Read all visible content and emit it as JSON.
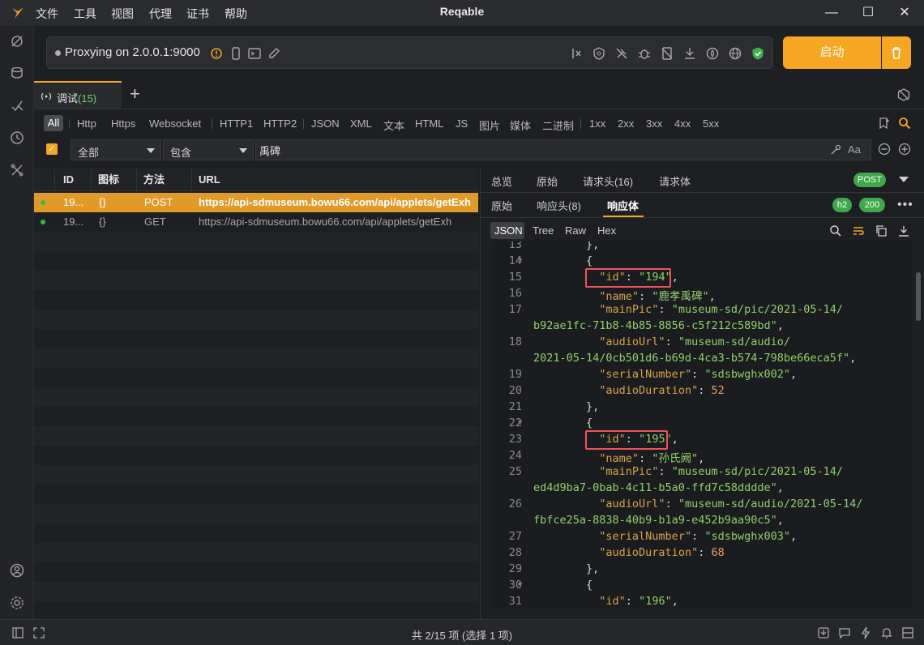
{
  "app": {
    "title": "Reqable",
    "menu": [
      "文件",
      "工具",
      "视图",
      "代理",
      "证书",
      "帮助"
    ]
  },
  "proxy": {
    "status_text": "Proxying on 2.0.0.1:9000",
    "start_label": "启动"
  },
  "tabs": {
    "debug_label": "调试",
    "debug_count": "(15)"
  },
  "filters": [
    "All",
    "Http",
    "Https",
    "Websocket",
    "HTTP1",
    "HTTP2",
    "JSON",
    "XML",
    "文本",
    "HTML",
    "JS",
    "图片",
    "媒体",
    "二进制",
    "1xx",
    "2xx",
    "3xx",
    "4xx",
    "5xx"
  ],
  "search": {
    "scope": "全部",
    "mode": "包含",
    "query": "禹碑",
    "case_label": "Aa"
  },
  "table": {
    "headers": [
      "ID",
      "图标",
      "方法",
      "URL"
    ],
    "rows": [
      {
        "id": "19...",
        "icon": "{}",
        "method": "POST",
        "url": "https://api-sdmuseum.bowu66.com/api/applets/getExh",
        "selected": true
      },
      {
        "id": "19...",
        "icon": "{}",
        "method": "GET",
        "url": "https://api-sdmuseum.bowu66.com/api/applets/getExh",
        "selected": false
      }
    ]
  },
  "request_tabs": [
    "总览",
    "原始",
    "请求头(16)",
    "请求体"
  ],
  "method_badge": "POST",
  "response_tabs": [
    "原始",
    "响应头(8)",
    "响应体"
  ],
  "protocol_badge": "h2",
  "status_badge": "200",
  "view_tabs": [
    "JSON",
    "Tree",
    "Raw",
    "Hex"
  ],
  "code_lines": [
    {
      "n": "13",
      "text": "        },"
    },
    {
      "n": "14",
      "text": "        {",
      "fold": true
    },
    {
      "n": "15",
      "key": "id",
      "val": "\"194\"",
      "type": "s",
      "indent": 10,
      "comma": true
    },
    {
      "n": "16",
      "key": "name",
      "val": "\"鹿孝禹碑\"",
      "type": "s",
      "indent": 10,
      "comma": true
    },
    {
      "n": "17",
      "key": "mainPic",
      "val": "\"museum-sd/pic/2021-05-14/",
      "type": "s",
      "indent": 10
    },
    {
      "n": "",
      "cont": "b92ae1fc-71b8-4b85-8856-c5f212c589bd\","
    },
    {
      "n": "18",
      "key": "audioUrl",
      "val": "\"museum-sd/audio/",
      "type": "s",
      "indent": 10
    },
    {
      "n": "",
      "cont": "2021-05-14/0cb501d6-b69d-4ca3-b574-798be66eca5f\","
    },
    {
      "n": "19",
      "key": "serialNumber",
      "val": "\"sdsbwghx002\"",
      "type": "s",
      "indent": 10,
      "comma": true
    },
    {
      "n": "20",
      "key": "audioDuration",
      "val": "52",
      "type": "n",
      "indent": 10
    },
    {
      "n": "21",
      "text": "        },"
    },
    {
      "n": "22",
      "text": "        {",
      "fold": true
    },
    {
      "n": "23",
      "key": "id",
      "val": "\"195\"",
      "type": "s",
      "indent": 10,
      "comma": true
    },
    {
      "n": "24",
      "key": "name",
      "val": "\"孙氏阙\"",
      "type": "s",
      "indent": 10,
      "comma": true
    },
    {
      "n": "25",
      "key": "mainPic",
      "val": "\"museum-sd/pic/2021-05-14/",
      "type": "s",
      "indent": 10
    },
    {
      "n": "",
      "cont": "ed4d9ba7-0bab-4c11-b5a0-ffd7c58dddde\","
    },
    {
      "n": "26",
      "key": "audioUrl",
      "val": "\"museum-sd/audio/2021-05-14/",
      "type": "s",
      "indent": 10
    },
    {
      "n": "",
      "cont": "fbfce25a-8838-40b9-b1a9-e452b9aa90c5\","
    },
    {
      "n": "27",
      "key": "serialNumber",
      "val": "\"sdsbwghx003\"",
      "type": "s",
      "indent": 10,
      "comma": true
    },
    {
      "n": "28",
      "key": "audioDuration",
      "val": "68",
      "type": "n",
      "indent": 10
    },
    {
      "n": "29",
      "text": "        },"
    },
    {
      "n": "30",
      "text": "        {",
      "fold": true
    },
    {
      "n": "31",
      "key": "id",
      "val": "\"196\"",
      "type": "s",
      "indent": 10,
      "comma": true
    }
  ],
  "status": {
    "text": "共 2/15 项 (选择 1 项)"
  }
}
